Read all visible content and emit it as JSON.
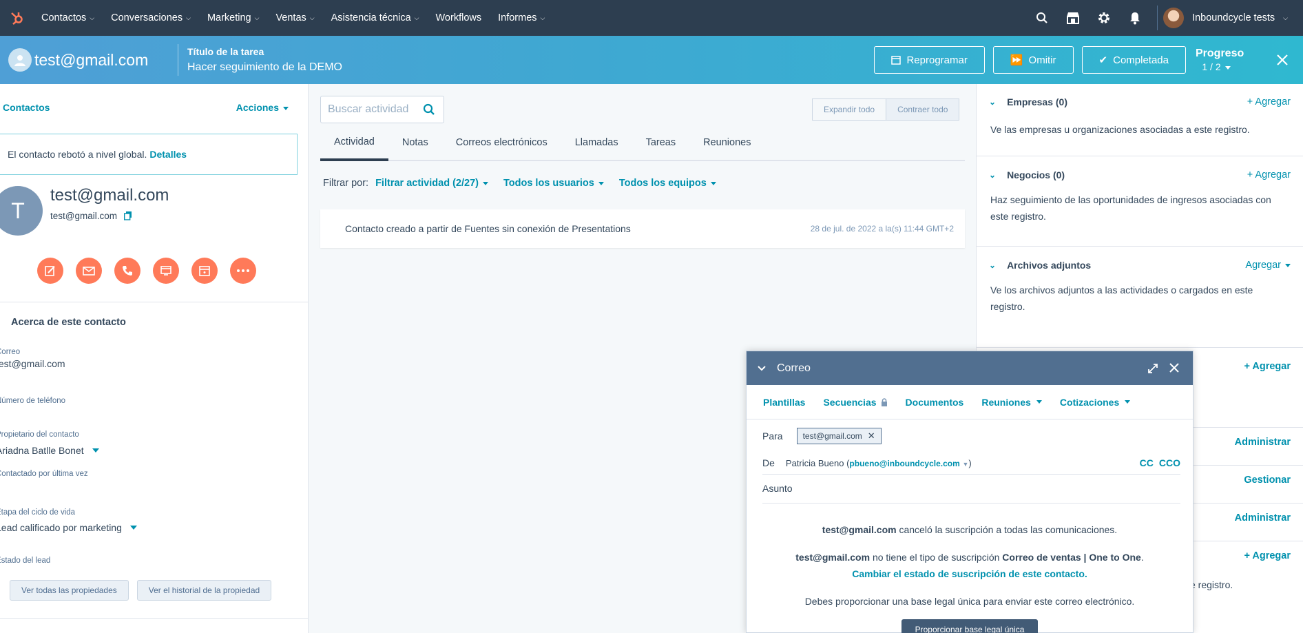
{
  "nav": {
    "menu": [
      "Contactos",
      "Conversaciones",
      "Marketing",
      "Ventas",
      "Asistencia técnica",
      "Workflows",
      "Informes"
    ],
    "account": "Inboundcycle tests"
  },
  "task": {
    "contact_email": "test@gmail.com",
    "title_label": "Título de la tarea",
    "title_value": "Hacer seguimiento de la DEMO",
    "reschedule": "Reprogramar",
    "skip": "Omitir",
    "complete": "Completada",
    "progress_label": "Progreso",
    "progress_value": "1 / 2"
  },
  "left": {
    "contacts_link": "Contactos",
    "actions": "Acciones",
    "bounce_text": "El contacto rebotó a nivel global.",
    "bounce_link": "Detalles",
    "avatar_letter": "T",
    "name": "test@gmail.com",
    "email": "test@gmail.com",
    "about_title": "Acerca de este contacto",
    "props": [
      {
        "label": "Correo",
        "value": "test@gmail.com"
      },
      {
        "label": "Número de teléfono",
        "value": ""
      },
      {
        "label": "Propietario del contacto",
        "value": "Ariadna Batlle Bonet"
      },
      {
        "label": "Contactado por última vez",
        "value": "-"
      },
      {
        "label": "Etapa del ciclo de vida",
        "value": "Lead calificado por marketing"
      },
      {
        "label": "Estado del lead",
        "value": ""
      }
    ],
    "view_all": "Ver todas las propiedades",
    "view_history": "Ver el historial de la propiedad"
  },
  "middle": {
    "search_placeholder": "Buscar actividad",
    "expand_all": "Expandir todo",
    "collapse_all": "Contraer todo",
    "tabs": [
      "Actividad",
      "Notas",
      "Correos electrónicos",
      "Llamadas",
      "Tareas",
      "Reuniones"
    ],
    "filter_label": "Filtrar por:",
    "filter_activity": "Filtrar actividad (2/27)",
    "filter_users": "Todos los usuarios",
    "filter_teams": "Todos los equipos",
    "activity_text": "Contacto creado a partir de Fuentes sin conexión de Presentations",
    "activity_date": "28 de jul. de 2022 a la(s) 11:44 GMT+2"
  },
  "right": {
    "companies": {
      "title": "Empresas (0)",
      "add": "+ Agregar",
      "text": "Ve las empresas u organizaciones asociadas a este registro."
    },
    "deals": {
      "title": "Negocios (0)",
      "add": "+ Agregar",
      "text": "Haz seguimiento de las oportunidades de ingresos asociadas con este registro."
    },
    "attachments": {
      "title": "Archivos adjuntos",
      "add": "Agregar",
      "text": "Ve los archivos adjuntos a las actividades o cargados en este registro."
    },
    "links": [
      "+ Agregar",
      "Administrar",
      "Gestionar",
      "Administrar",
      "+ Agregar"
    ],
    "partial_text": "e registro."
  },
  "composer": {
    "title": "Correo",
    "tools": [
      "Plantillas",
      "Secuencias",
      "Documentos",
      "Reuniones",
      "Cotizaciones"
    ],
    "to_label": "Para",
    "to_chip": "test@gmail.com",
    "from_label": "De",
    "from_name": "Patricia Bueno",
    "from_email": "pbueno@inboundcycle.com",
    "cc": "CC",
    "bcc": "CCO",
    "subject_label": "Asunto",
    "msg1_bold": "test@gmail.com",
    "msg1_rest": "canceló la suscripción a todas las comunicaciones.",
    "msg2_bold": "test@gmail.com",
    "msg2_mid": "no tiene el tipo de suscripción",
    "msg2_type": "Correo de ventas | One to One",
    "msg2_link": "Cambiar el estado de suscripción de este contacto.",
    "msg3": "Debes proporcionar una base legal única para enviar este correo electrónico.",
    "legal_button": "Proporcionar base legal única"
  },
  "colors": {
    "nav": "#2d3e50",
    "accent": "#ff7a59",
    "link": "#0091ae",
    "composer_head": "#516f90"
  }
}
